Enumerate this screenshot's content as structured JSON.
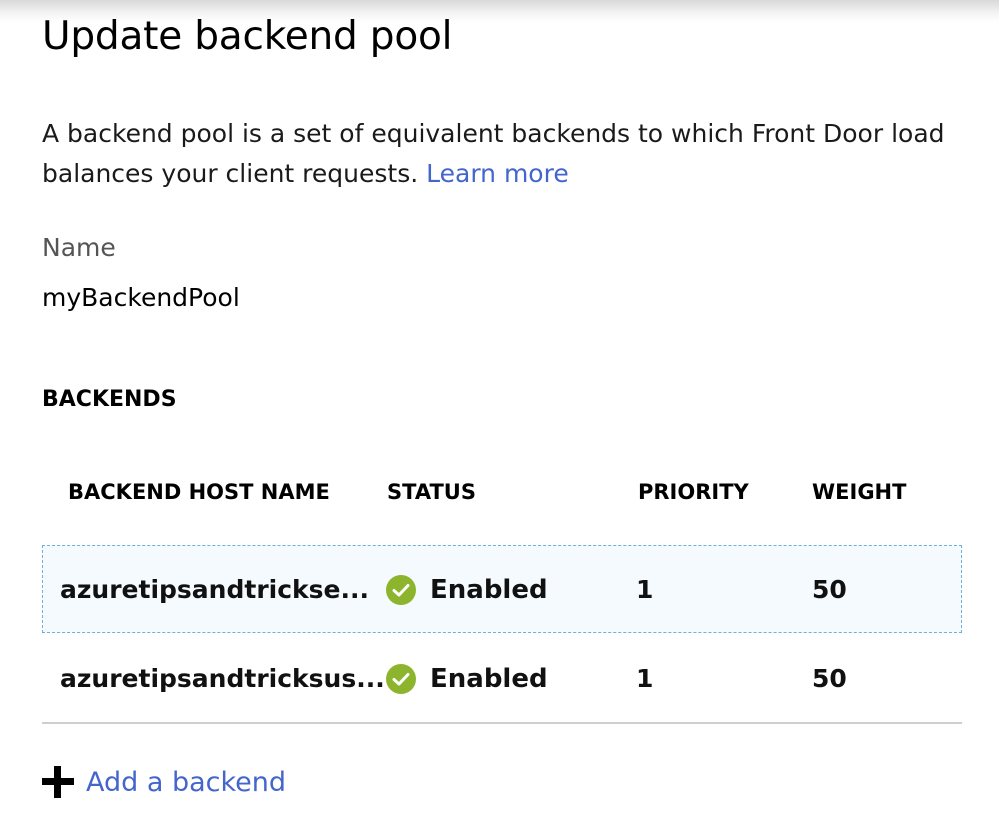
{
  "panel": {
    "title": "Update backend pool",
    "description": "A backend pool is a set of equivalent backends to which Front Door load balances your client requests.",
    "learn_more": "Learn more"
  },
  "name_field": {
    "label": "Name",
    "value": "myBackendPool"
  },
  "backends": {
    "heading": "BACKENDS",
    "columns": {
      "host": "BACKEND HOST NAME",
      "status": "STATUS",
      "priority": "PRIORITY",
      "weight": "WEIGHT"
    },
    "rows": [
      {
        "host": "azuretipsandtrickse...",
        "status": "Enabled",
        "priority": "1",
        "weight": "50",
        "status_icon": "check-circle-icon"
      },
      {
        "host": "azuretipsandtricksus...",
        "status": "Enabled",
        "priority": "1",
        "weight": "50",
        "status_icon": "check-circle-icon"
      }
    ]
  },
  "add_backend": {
    "label": "Add a backend",
    "icon": "plus-icon"
  },
  "colors": {
    "link": "#4466cc",
    "enabled": "#8cb52d",
    "selected_row_bg": "#f4fafd",
    "selected_row_border": "#6eb0d8"
  }
}
